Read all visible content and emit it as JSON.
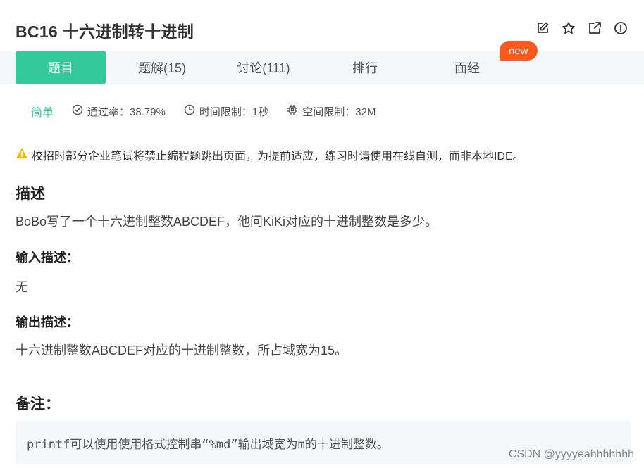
{
  "problem": {
    "title": "BC16  十六进制转十进制"
  },
  "toolbar": {
    "icons": [
      "edit-icon",
      "star-icon",
      "external-link-icon",
      "info-icon"
    ]
  },
  "tabs": [
    {
      "label": "题目",
      "active": true
    },
    {
      "label": "题解(15)",
      "active": false
    },
    {
      "label": "讨论(111)",
      "active": false
    },
    {
      "label": "排行",
      "active": false
    },
    {
      "label": "面经",
      "active": false
    }
  ],
  "new_badge": "new",
  "meta": {
    "difficulty": "简单",
    "pass_rate": "通过率：38.79%",
    "time_limit": "时间限制：1秒",
    "space_limit": "空间限制：32M"
  },
  "notice": "校招时部分企业笔试将禁止编程题跳出页面，为提前适应，练习时请使用在线自测，而非本地IDE。",
  "description": {
    "heading": "描述",
    "text": "BoBo写了一个十六进制整数ABCDEF，他问KiKi对应的十进制整数是多少。"
  },
  "input_desc": {
    "heading": "输入描述：",
    "text": "无"
  },
  "output_desc": {
    "heading": "输出描述：",
    "text": "十六进制整数ABCDEF对应的十进制整数，所占域宽为15。"
  },
  "note": {
    "heading": "备注：",
    "code": "printf可以使用使用格式控制串“%md”输出域宽为m的十进制整数。"
  },
  "watermark": "CSDN @yyyyeahhhhhhh",
  "colors": {
    "accent": "#32ca99",
    "badge": "#fa5a1e",
    "warning": "#f5b800"
  }
}
